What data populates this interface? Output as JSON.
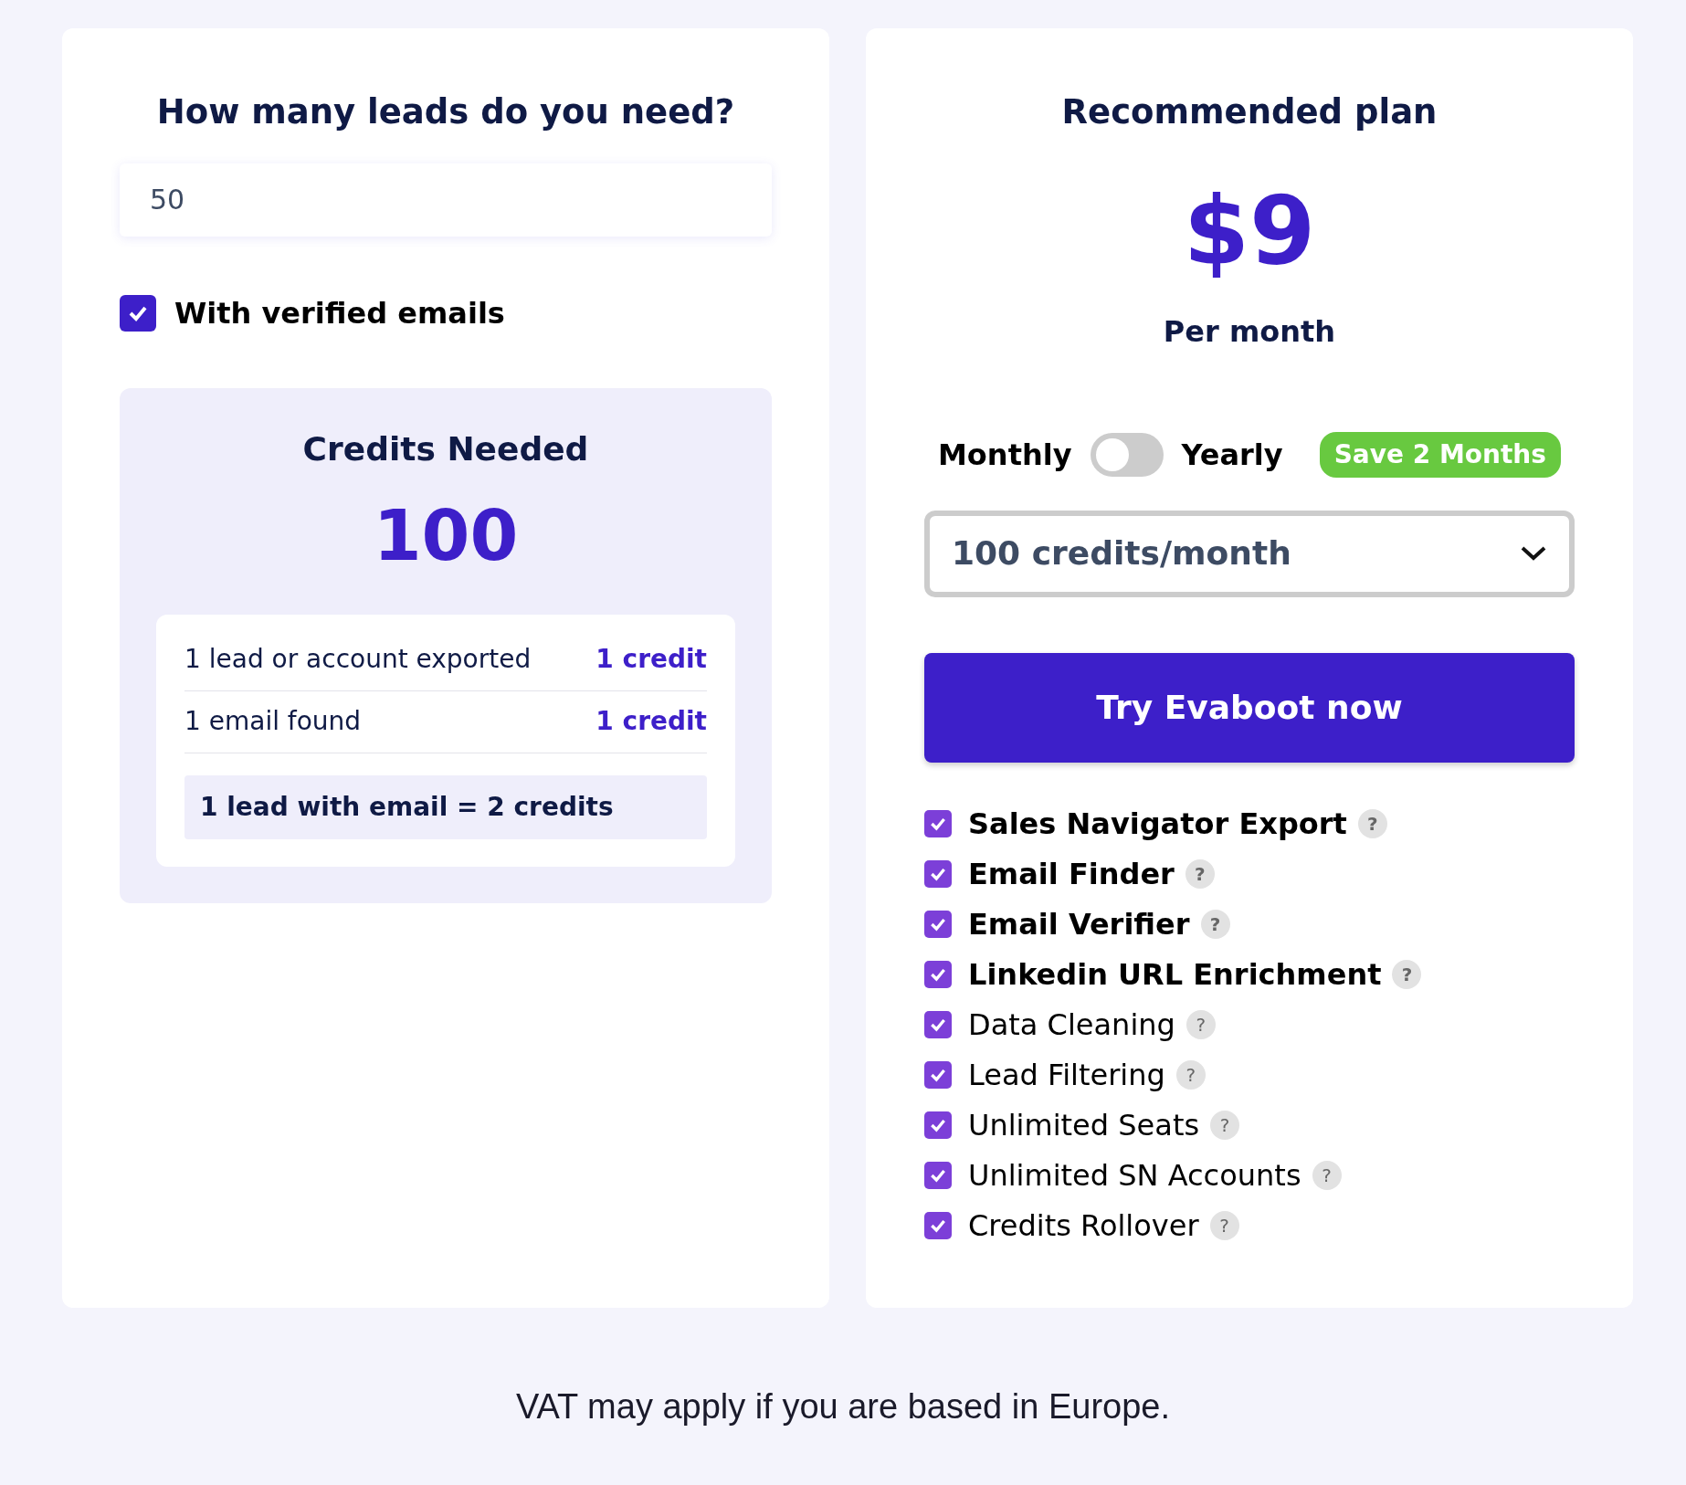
{
  "calculator": {
    "title": "How many leads do you need?",
    "leads_input": {
      "value": "50"
    },
    "verified_emails": {
      "label": "With verified emails",
      "checked": true
    },
    "credits": {
      "title": "Credits Needed",
      "total": "100",
      "rows": [
        {
          "label": "1 lead or account exported",
          "value": "1 credit"
        },
        {
          "label": "1 email found",
          "value": "1 credit"
        }
      ],
      "summary": "1 lead with email = 2 credits"
    }
  },
  "plan": {
    "title": "Recommended plan",
    "price": "$9",
    "period": "Per month",
    "billing": {
      "left": "Monthly",
      "right": "Yearly",
      "on": false,
      "badge": "Save 2 Months"
    },
    "select": {
      "value": "100 credits/month"
    },
    "cta": "Try Evaboot now",
    "features": [
      {
        "label": "Sales Navigator Export",
        "checked": true,
        "bold": true,
        "help": "?"
      },
      {
        "label": "Email Finder",
        "checked": true,
        "bold": true,
        "help": "?"
      },
      {
        "label": "Email Verifier",
        "checked": true,
        "bold": true,
        "help": "?"
      },
      {
        "label": "Linkedin URL Enrichment",
        "checked": true,
        "bold": true,
        "help": "?"
      },
      {
        "label": "Data Cleaning",
        "checked": true,
        "bold": false,
        "help": "?"
      },
      {
        "label": "Lead Filtering",
        "checked": true,
        "bold": false,
        "help": "?"
      },
      {
        "label": "Unlimited Seats",
        "checked": true,
        "bold": false,
        "help": "?"
      },
      {
        "label": "Unlimited SN Accounts",
        "checked": true,
        "bold": false,
        "help": "?"
      },
      {
        "label": "Credits Rollover",
        "checked": true,
        "bold": false,
        "help": "?"
      }
    ]
  },
  "footer": "VAT may apply if you are based in Europe."
}
